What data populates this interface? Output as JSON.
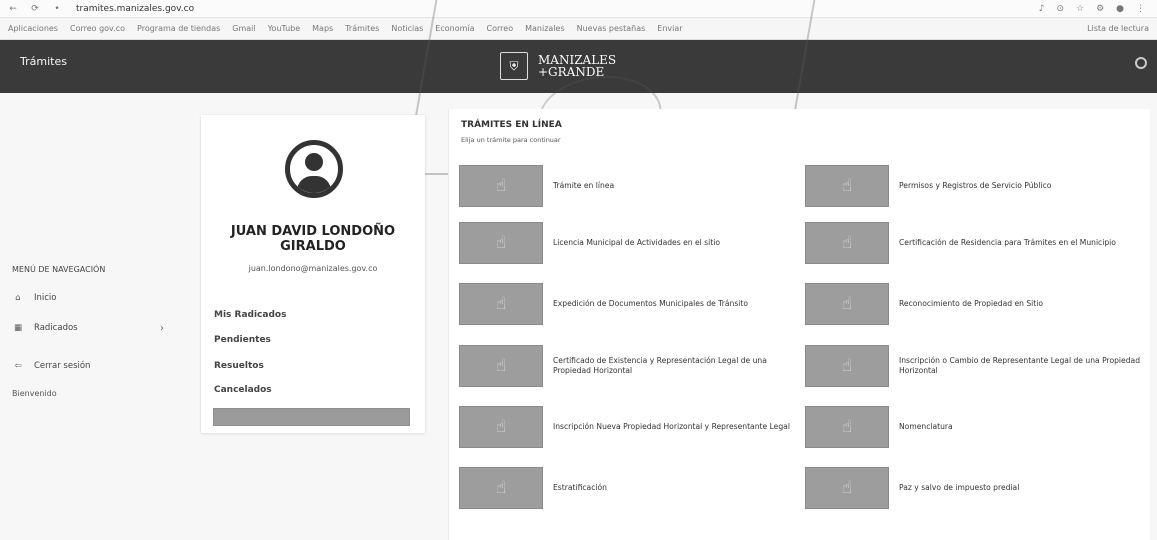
{
  "browser": {
    "url": "tramites.manizales.gov.co",
    "nav": [
      "←",
      "⟳",
      "•"
    ],
    "controls": [
      "♪",
      "⊙",
      "☆",
      "⚙",
      "●",
      "⋮"
    ],
    "bookmarks": [
      "Aplicaciones",
      "Correo gov.co",
      "Programa de tiendas",
      "Gmail",
      "YouTube",
      "Maps",
      "Trámites",
      "Noticias",
      "Economía",
      "Correo",
      "Manizales",
      "Nuevas pestañas",
      "Enviar"
    ],
    "bookmarks_right": "Lista de lectura"
  },
  "header": {
    "title": "Trámites",
    "logo_line1": "MANIZALES",
    "logo_line2": "+GRANDE"
  },
  "sidebar": {
    "section_label": "MENÚ DE NAVEGACIÓN",
    "items": [
      {
        "label": "Inicio",
        "icon": "home-icon",
        "glyph": "⌂"
      },
      {
        "label": "Radicados",
        "icon": "grid-icon",
        "glyph": "▦"
      },
      {
        "label": "Cerrar sesión",
        "icon": "logout-icon",
        "glyph": "⇦"
      }
    ],
    "chevron": "›",
    "footer": "Bienvenido"
  },
  "profile": {
    "name": "JUAN DAVID LONDOÑO GIRALDO",
    "email": "juan.londono@manizales.gov.co",
    "menu": [
      "Mis Radicados",
      "Pendientes",
      "Resueltos",
      "Cancelados"
    ],
    "button_label": ""
  },
  "main": {
    "title": "TRÁMITES EN LÍNEA",
    "subtitle": "Elija un trámite para continuar",
    "items": [
      "Trámite en línea",
      "Licencia Municipal de Actividades en el sitio",
      "Expedición de Documentos Municipales de Tránsito",
      "Certificado de Existencia y Representación Legal de una Propiedad Horizontal",
      "Inscripción Nueva Propiedad Horizontal y Representante Legal",
      "Estratificación",
      "Permisos y Registros de Servicio Público",
      "Certificación de Residencia para Trámites en el Municipio",
      "Reconocimiento de Propiedad en Sitio",
      "Inscripción o Cambio de Representante Legal de una Propiedad Horizontal",
      "Nomenclatura",
      "Paz y salvo de impuesto predial"
    ]
  }
}
